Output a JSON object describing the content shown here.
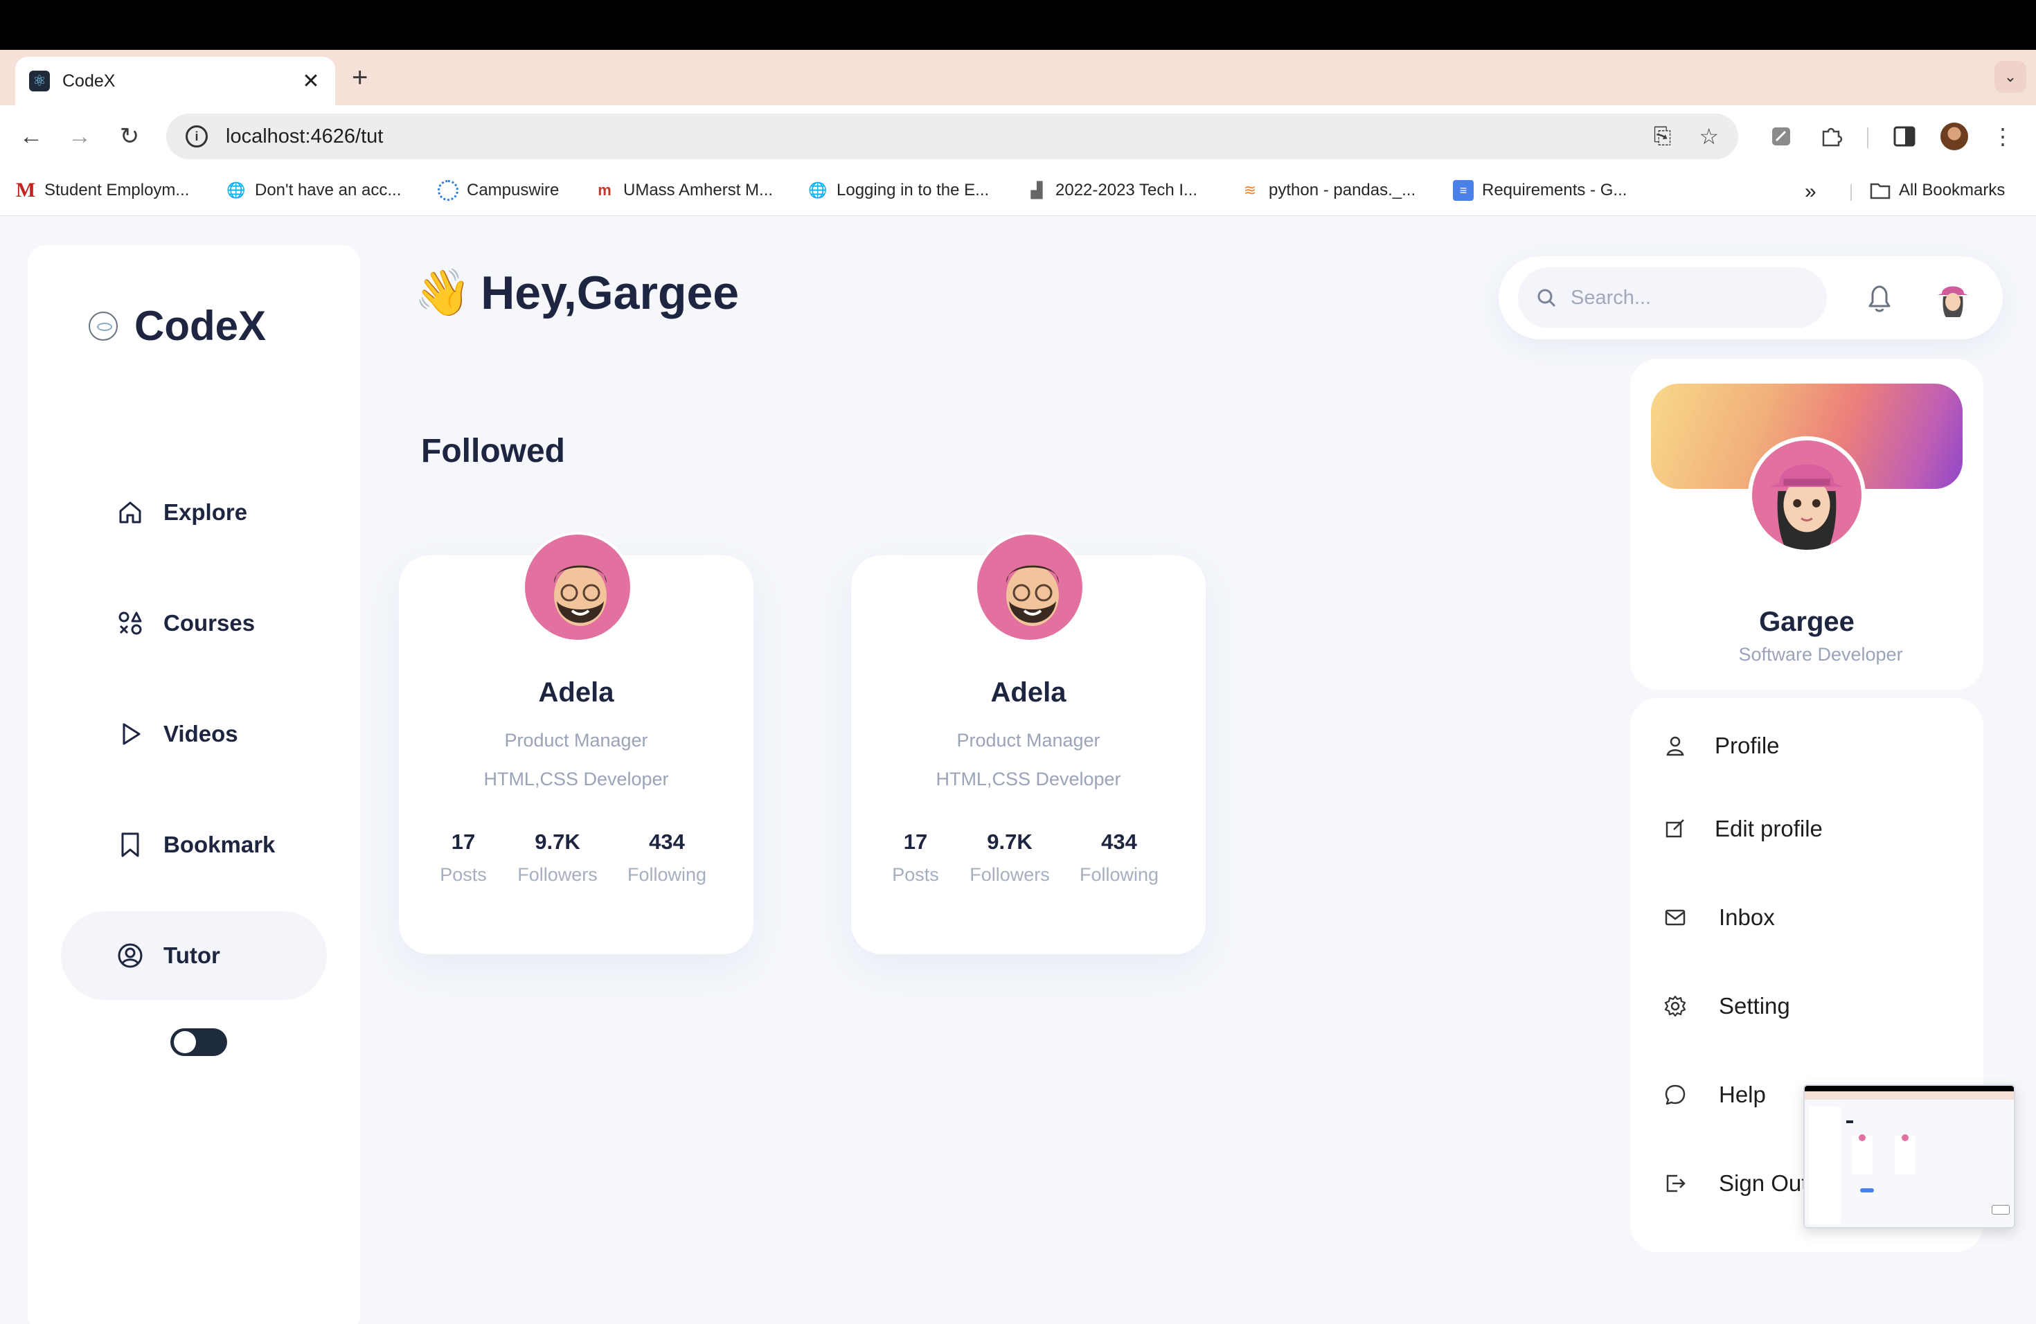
{
  "browser": {
    "tab_title": "CodeX",
    "url": "localhost:4626/tut",
    "bookmarks": [
      {
        "label": "Student Employm...",
        "icon": "gmail-icon"
      },
      {
        "label": "Don't have an acc...",
        "icon": "globe-icon"
      },
      {
        "label": "Campuswire",
        "icon": "campuswire-icon"
      },
      {
        "label": "UMass Amherst M...",
        "icon": "umass-icon"
      },
      {
        "label": "Logging in to the E...",
        "icon": "globe-icon"
      },
      {
        "label": "2022-2023 Tech I...",
        "icon": "chart-icon"
      },
      {
        "label": "python - pandas._...",
        "icon": "stackoverflow-icon"
      },
      {
        "label": "Requirements - G...",
        "icon": "docs-icon"
      }
    ],
    "all_bookmarks": "All Bookmarks"
  },
  "sidebar": {
    "logo": "CodeX",
    "items": [
      {
        "label": "Explore",
        "icon": "home-icon"
      },
      {
        "label": "Courses",
        "icon": "shapes-icon"
      },
      {
        "label": "Videos",
        "icon": "play-icon"
      },
      {
        "label": "Bookmark",
        "icon": "bookmark-icon"
      },
      {
        "label": "Tutor",
        "icon": "user-circle-icon",
        "active": true
      }
    ],
    "theme_toggle": "dark"
  },
  "main": {
    "wave": "👋",
    "greeting": "Hey,Gargee",
    "section_title": "Followed",
    "cards": [
      {
        "name": "Adela",
        "role": "Product Manager",
        "skill": "HTML,CSS Developer",
        "stats": [
          {
            "num": "17",
            "label": "Posts"
          },
          {
            "num": "9.7K",
            "label": "Followers"
          },
          {
            "num": "434",
            "label": "Following"
          }
        ]
      },
      {
        "name": "Adela",
        "role": "Product Manager",
        "skill": "HTML,CSS Developer",
        "stats": [
          {
            "num": "17",
            "label": "Posts"
          },
          {
            "num": "9.7K",
            "label": "Followers"
          },
          {
            "num": "434",
            "label": "Following"
          }
        ]
      }
    ]
  },
  "topbar": {
    "search_placeholder": "Search..."
  },
  "profile": {
    "name": "Gargee",
    "title": "Software Developer",
    "menu": [
      {
        "label": "Profile",
        "icon": "user-icon"
      },
      {
        "label": "Edit profile",
        "icon": "edit-icon"
      },
      {
        "label": "Inbox",
        "icon": "mail-icon"
      },
      {
        "label": "Setting",
        "icon": "gear-icon"
      },
      {
        "label": "Help",
        "icon": "chat-icon"
      },
      {
        "label": "Sign Out",
        "icon": "logout-icon"
      }
    ]
  },
  "colors": {
    "accent_dark": "#1d2540",
    "muted": "#9aa3b8",
    "avatar_pink": "#e2719f"
  }
}
